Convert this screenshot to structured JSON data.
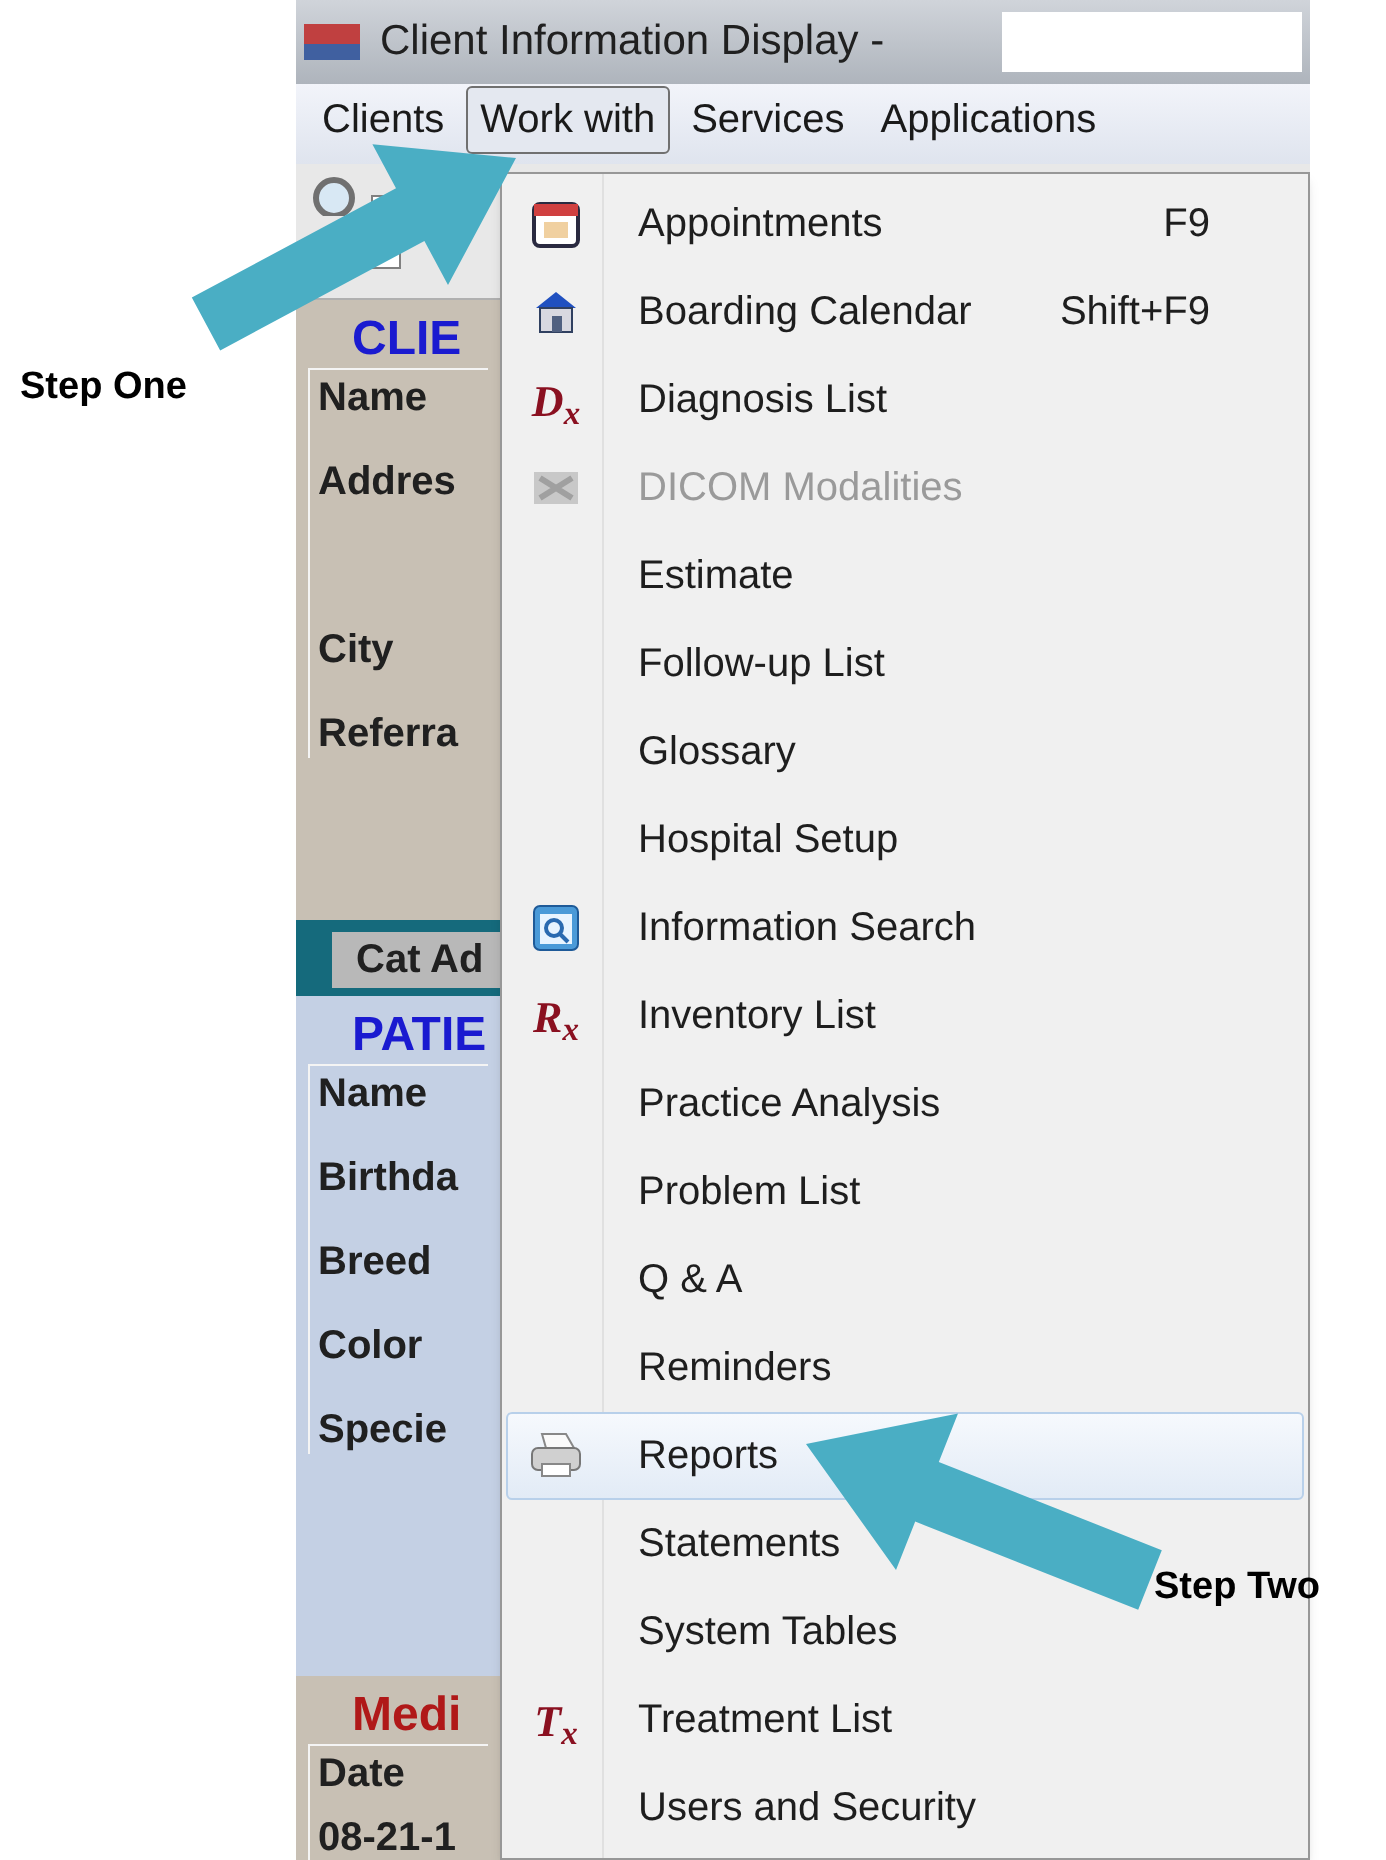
{
  "window": {
    "title": "Client Information Display -"
  },
  "menubar": [
    {
      "label": "Clients",
      "selected": false
    },
    {
      "label": "Work with",
      "selected": true
    },
    {
      "label": "Services",
      "selected": false
    },
    {
      "label": "Applications",
      "selected": false
    }
  ],
  "client_panel": {
    "title": "CLIE",
    "labels": [
      "Name",
      "Addres",
      "City",
      "Referra"
    ]
  },
  "tab": {
    "label": "Cat Ad"
  },
  "patient_panel": {
    "title": "PATIE",
    "labels": [
      "Name",
      "Birthda",
      "Breed",
      "Color",
      "Specie"
    ]
  },
  "medical_panel": {
    "title": "Medi",
    "labels": [
      "Date",
      "08-21-1"
    ]
  },
  "dropdown": [
    {
      "label": "Appointments",
      "shortcut": "F9",
      "kind": "calendar",
      "selected": false,
      "disabled": false
    },
    {
      "label": "Boarding Calendar",
      "shortcut": "Shift+F9",
      "kind": "house",
      "selected": false,
      "disabled": false
    },
    {
      "label": "Diagnosis List",
      "badge": "D$_{x}$",
      "selected": false,
      "disabled": false
    },
    {
      "label": "DICOM Modalities",
      "kind": "dicom",
      "selected": false,
      "disabled": true
    },
    {
      "label": "Estimate",
      "selected": false,
      "disabled": false
    },
    {
      "label": "Follow-up List",
      "selected": false,
      "disabled": false
    },
    {
      "label": "Glossary",
      "selected": false,
      "disabled": false
    },
    {
      "label": "Hospital Setup",
      "selected": false,
      "disabled": false
    },
    {
      "label": "Information Search",
      "kind": "search",
      "selected": false,
      "disabled": false
    },
    {
      "label": "Inventory List",
      "badge": "R$_{x}$",
      "selected": false,
      "disabled": false
    },
    {
      "label": "Practice Analysis",
      "selected": false,
      "disabled": false
    },
    {
      "label": "Problem List",
      "selected": false,
      "disabled": false
    },
    {
      "label": "Q & A",
      "selected": false,
      "disabled": false
    },
    {
      "label": "Reminders",
      "selected": false,
      "disabled": false
    },
    {
      "label": "Reports",
      "kind": "printer",
      "selected": true,
      "disabled": false
    },
    {
      "label": "Statements",
      "selected": false,
      "disabled": false
    },
    {
      "label": "System Tables",
      "selected": false,
      "disabled": false
    },
    {
      "label": "Treatment List",
      "badge": "T$_{x}$",
      "selected": false,
      "disabled": false
    },
    {
      "label": "Users and Security",
      "selected": false,
      "disabled": false
    }
  ],
  "annotations": [
    "Step One",
    "Step Two"
  ]
}
